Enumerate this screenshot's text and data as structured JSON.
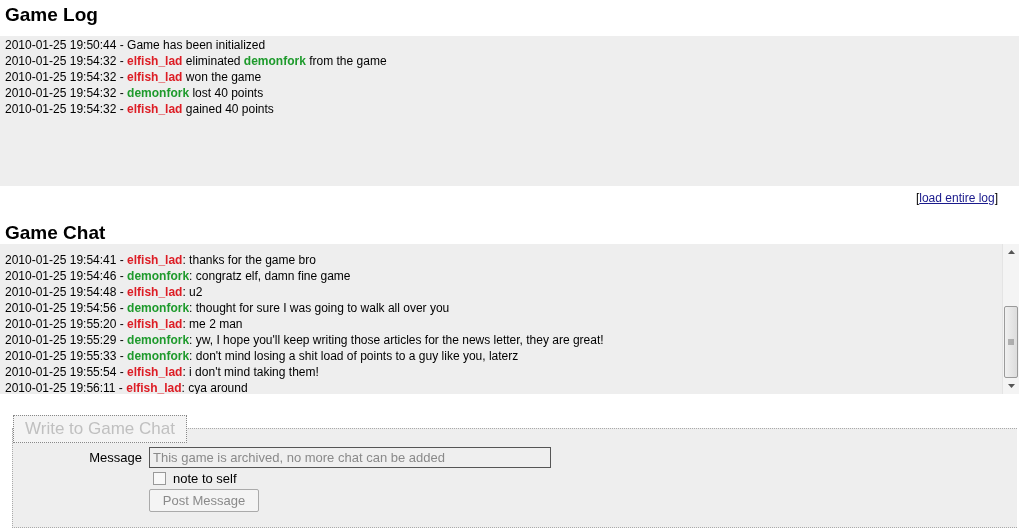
{
  "game_log": {
    "title": "Game Log",
    "separator": "-",
    "entries": [
      {
        "time": "2010-01-25 19:50:44",
        "parts": [
          {
            "kind": "text",
            "text": "Game has been initialized"
          }
        ]
      },
      {
        "time": "2010-01-25 19:54:32",
        "parts": [
          {
            "kind": "player",
            "text": "elfish_lad",
            "color": "#dd1c24"
          },
          {
            "kind": "text",
            "text": "eliminated"
          },
          {
            "kind": "player",
            "text": "demonfork",
            "color": "#1e9a2c"
          },
          {
            "kind": "text",
            "text": "from the game"
          }
        ]
      },
      {
        "time": "2010-01-25 19:54:32",
        "parts": [
          {
            "kind": "player",
            "text": "elfish_lad",
            "color": "#dd1c24"
          },
          {
            "kind": "text",
            "text": "won the game"
          }
        ]
      },
      {
        "time": "2010-01-25 19:54:32",
        "parts": [
          {
            "kind": "player",
            "text": "demonfork",
            "color": "#1e9a2c"
          },
          {
            "kind": "text",
            "text": "lost 40 points"
          }
        ]
      },
      {
        "time": "2010-01-25 19:54:32",
        "parts": [
          {
            "kind": "player",
            "text": "elfish_lad",
            "color": "#dd1c24"
          },
          {
            "kind": "text",
            "text": "gained 40 points"
          }
        ]
      }
    ],
    "link_open": "[",
    "link": "load entire log",
    "link_close": "]"
  },
  "game_chat": {
    "title": "Game Chat",
    "separator": "-",
    "name_suffix": ":",
    "messages": [
      {
        "time": "2010-01-25 19:54:41",
        "player": "elfish_lad",
        "color": "#dd1c24",
        "text": "thanks for the game bro"
      },
      {
        "time": "2010-01-25 19:54:46",
        "player": "demonfork",
        "color": "#1e9a2c",
        "text": "congratz elf, damn fine game"
      },
      {
        "time": "2010-01-25 19:54:48",
        "player": "elfish_lad",
        "color": "#dd1c24",
        "text": "u2"
      },
      {
        "time": "2010-01-25 19:54:56",
        "player": "demonfork",
        "color": "#1e9a2c",
        "text": "thought for sure I was going to walk all over you"
      },
      {
        "time": "2010-01-25 19:55:20",
        "player": "elfish_lad",
        "color": "#dd1c24",
        "text": "me 2 man"
      },
      {
        "time": "2010-01-25 19:55:29",
        "player": "demonfork",
        "color": "#1e9a2c",
        "text": "yw, I hope you'll keep writing those articles for the news letter, they are great!"
      },
      {
        "time": "2010-01-25 19:55:33",
        "player": "demonfork",
        "color": "#1e9a2c",
        "text": "don't mind losing a shit load of points to a guy like you, laterz"
      },
      {
        "time": "2010-01-25 19:55:54",
        "player": "elfish_lad",
        "color": "#dd1c24",
        "text": "i don't mind taking them!"
      },
      {
        "time": "2010-01-25 19:56:11",
        "player": "elfish_lad",
        "color": "#dd1c24",
        "text": "cya around"
      }
    ]
  },
  "write_form": {
    "legend": "Write to Game Chat",
    "message_label": "Message",
    "message": {
      "value": "This game is archived, no more chat can be added",
      "disabled": true
    },
    "note_to_self": {
      "label": "note to self",
      "checked": false
    },
    "post_button": {
      "label": "Post Message",
      "disabled": true
    }
  }
}
